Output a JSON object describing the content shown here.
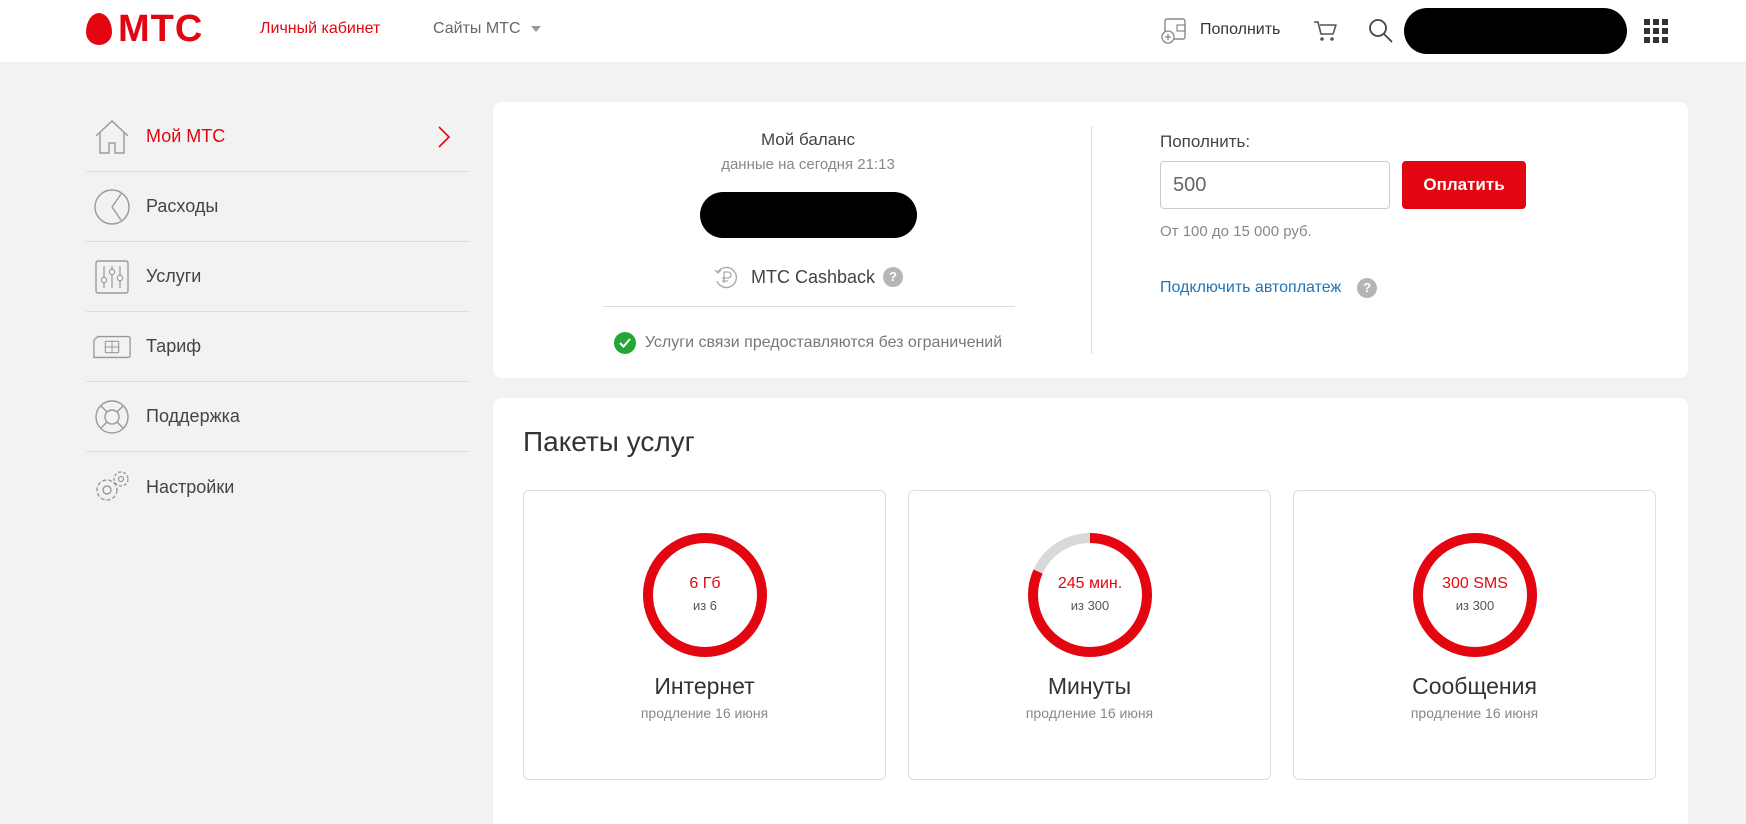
{
  "header": {
    "logo_text": "МТС",
    "nav_lk": "Личный кабинет",
    "nav_sites": "Сайты МТС",
    "topup_label": "Пополнить"
  },
  "sidebar": {
    "items": [
      {
        "label": "Мой МТС",
        "icon": "home-icon",
        "active": true
      },
      {
        "label": "Расходы",
        "icon": "pie-chart-icon"
      },
      {
        "label": "Услуги",
        "icon": "sliders-icon"
      },
      {
        "label": "Тариф",
        "icon": "sim-card-icon"
      },
      {
        "label": "Поддержка",
        "icon": "lifebuoy-icon"
      },
      {
        "label": "Настройки",
        "icon": "gears-icon"
      }
    ]
  },
  "balance": {
    "title": "Мой баланс",
    "subtitle": "данные на сегодня 21:13",
    "cashback_label": "МТС Cashback",
    "help_symbol": "?",
    "status_text": "Услуги связи предоставляются без ограничений"
  },
  "topup": {
    "title": "Пополнить:",
    "amount_value": "500",
    "pay_button": "Оплатить",
    "hint": "От 100 до 15 000 руб.",
    "autopay_link": "Подключить автоплатеж"
  },
  "packages": {
    "title": "Пакеты услуг",
    "items": [
      {
        "value": "6 Гб",
        "of": "из 6",
        "name": "Интернет",
        "renew": "продление 16 июня",
        "fraction": 1.0
      },
      {
        "value": "245 мин.",
        "of": "из 300",
        "name": "Минуты",
        "renew": "продление 16 июня",
        "fraction": 0.8167
      },
      {
        "value": "300 SMS",
        "of": "из 300",
        "name": "Сообщения",
        "renew": "продление 16 июня",
        "fraction": 1.0
      }
    ]
  },
  "colors": {
    "brand": "#e30611",
    "ring_track": "#d9d9d9",
    "link": "#1f73b6",
    "success": "#23a635"
  }
}
